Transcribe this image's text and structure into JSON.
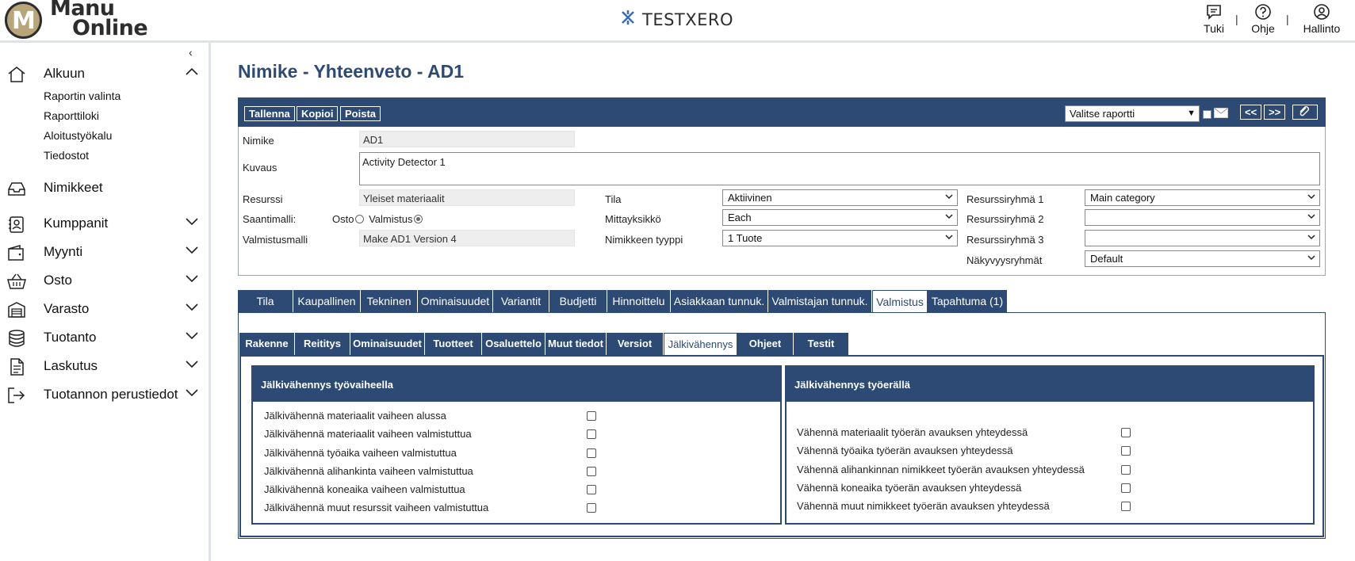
{
  "header": {
    "logo_line1": "Manu",
    "logo_line2": "Online",
    "logo_letter": "M",
    "brand": "TESTXERO",
    "actions": [
      {
        "label": "Tuki",
        "icon": "chat-icon"
      },
      {
        "label": "Ohje",
        "icon": "help-icon"
      },
      {
        "label": "Hallinto",
        "icon": "user-icon"
      }
    ],
    "sep": "|"
  },
  "sidebar": {
    "collapse": "‹",
    "items": [
      {
        "label": "Alkuun",
        "icon": "home-icon",
        "expanded": true
      },
      {
        "label": "Nimikkeet",
        "icon": "inbox-icon"
      },
      {
        "label": "Kumppanit",
        "icon": "contacts-icon"
      },
      {
        "label": "Myynti",
        "icon": "wallet-icon"
      },
      {
        "label": "Osto",
        "icon": "basket-icon"
      },
      {
        "label": "Varasto",
        "icon": "warehouse-icon"
      },
      {
        "label": "Tuotanto",
        "icon": "database-icon"
      },
      {
        "label": "Laskutus",
        "icon": "document-icon"
      },
      {
        "label": "Tuotannon perustiedot",
        "icon": "logout-icon"
      }
    ],
    "subitems": [
      "Raportin valinta",
      "Raporttiloki",
      "Aloitustyökalu",
      "Tiedostot"
    ]
  },
  "page": {
    "title": "Nimike - Yhteenveto - AD1",
    "toolbar": {
      "save": "Tallenna",
      "copy": "Kopioi",
      "delete": "Poista",
      "report_select": "Valitse raportti",
      "prev": "<<",
      "next": ">>"
    },
    "form": {
      "nimike_label": "Nimike",
      "nimike_value": "AD1",
      "kuvaus_label": "Kuvaus",
      "kuvaus_value": "Activity Detector 1",
      "resurssi_label": "Resurssi",
      "resurssi_value": "Yleiset materiaalit",
      "saanti_label": "Saantimalli:",
      "saanti_osto": "Osto",
      "saanti_valmistus": "Valmistus",
      "valmistusmalli_label": "Valmistusmalli",
      "valmistusmalli_value": "Make AD1 Version 4",
      "tila_label": "Tila",
      "tila_value": "Aktiivinen",
      "mitta_label": "Mittayksikkö",
      "mitta_value": "Each",
      "tyyppi_label": "Nimikkeen tyyppi",
      "tyyppi_value": "1 Tuote",
      "rr1_label": "Resurssiryhmä 1",
      "rr1_value": "Main category",
      "rr2_label": "Resurssiryhmä 2",
      "rr2_value": "",
      "rr3_label": "Resurssiryhmä 3",
      "rr3_value": "",
      "nak_label": "Näkyvyysryhmät",
      "nak_value": "Default"
    },
    "tabs": [
      "Tila",
      "Kaupallinen",
      "Tekninen",
      "Ominaisuudet",
      "Variantit",
      "Budjetti",
      "Hinnoittelu",
      "Asiakkaan tunnuk.",
      "Valmistajan tunnuk.",
      "Valmistus",
      "Tapahtuma (1)"
    ],
    "active_tab": "Valmistus",
    "subtabs": [
      "Rakenne",
      "Reititys",
      "Ominaisuudet",
      "Tuotteet",
      "Osaluettelo",
      "Muut tiedot",
      "Versiot",
      "Jälkivähennys",
      "Ohjeet",
      "Testit"
    ],
    "active_subtab": "Jälkivähennys",
    "left_box": {
      "title": "Jälkivähennys työvaiheella",
      "rows": [
        "Jälkivähennä materiaalit vaiheen alussa",
        "Jälkivähennä materiaalit vaiheen valmistuttua",
        "Jälkivähennä työaika vaiheen valmistuttua",
        "Jälkivähennä alihankinta vaiheen valmistuttua",
        "Jälkivähennä koneaika vaiheen valmistuttua",
        "Jälkivähennä muut resurssit vaiheen valmistuttua"
      ]
    },
    "right_box": {
      "title": "Jälkivähennys työerällä",
      "rows": [
        "Vähennä materiaalit työerän avauksen yhteydessä",
        "Vähennä työaika työerän avauksen yhteydessä",
        "Vähennä alihankinnan nimikkeet työerän avauksen yhteydessä",
        "Vähennä koneaika työerän avauksen yhteydessä",
        "Vähennä muut nimikkeet työerän avauksen yhteydessä"
      ]
    }
  }
}
